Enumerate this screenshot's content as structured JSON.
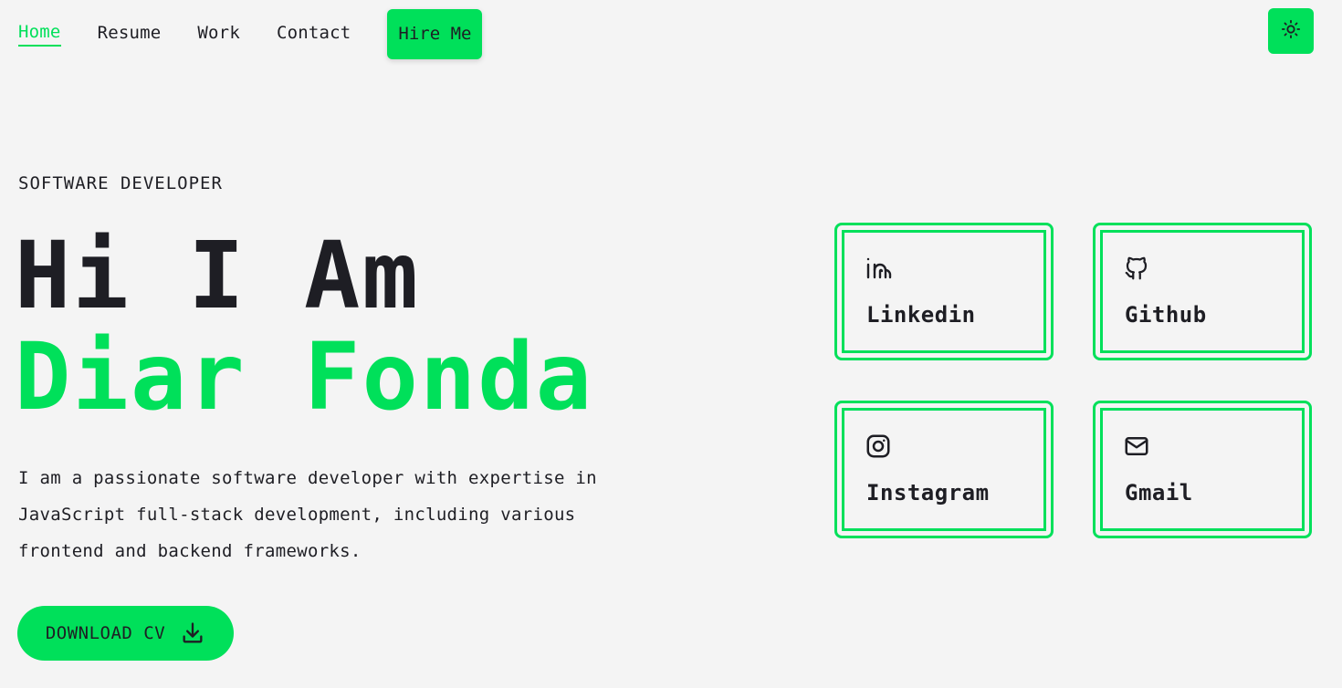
{
  "nav": {
    "links": [
      {
        "label": "Home",
        "active": true
      },
      {
        "label": "Resume",
        "active": false
      },
      {
        "label": "Work",
        "active": false
      },
      {
        "label": "Contact",
        "active": false
      }
    ],
    "hire_label": "Hire Me",
    "theme_icon": "sun-icon"
  },
  "hero": {
    "subtitle": "SOFTWARE DEVELOPER",
    "greeting": "Hi I Am",
    "name": "Diar Fonda",
    "description": "I am a passionate software developer with expertise in JavaScript full-stack development, including various frontend and backend frameworks.",
    "cv_label": "DOWNLOAD CV",
    "cv_icon": "download-icon"
  },
  "socials": [
    {
      "label": "Linkedin",
      "icon": "linkedin-icon"
    },
    {
      "label": "Github",
      "icon": "github-icon"
    },
    {
      "label": "Instagram",
      "icon": "instagram-icon"
    },
    {
      "label": "Gmail",
      "icon": "mail-icon"
    }
  ],
  "colors": {
    "accent": "#00e05a",
    "text": "#1e1e24",
    "background": "#f4f4f4"
  }
}
